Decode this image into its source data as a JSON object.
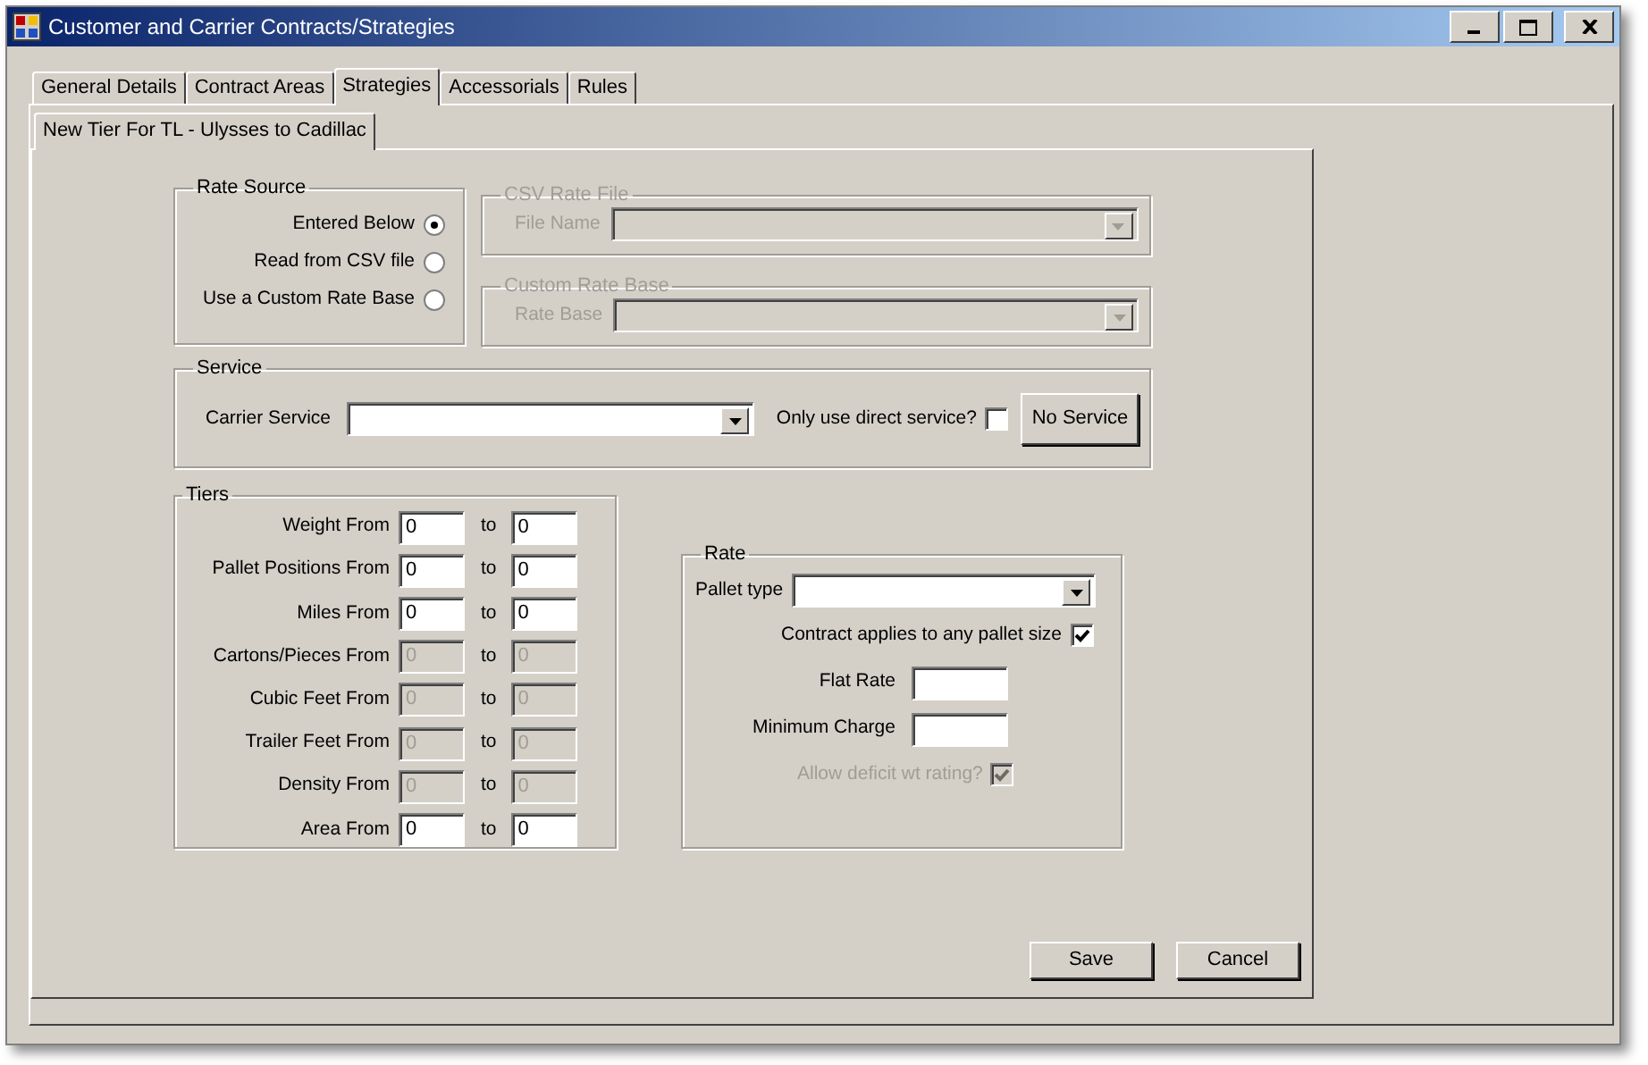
{
  "window": {
    "title": "Customer and Carrier Contracts/Strategies"
  },
  "tabs": [
    {
      "label": "General Details",
      "selected": false
    },
    {
      "label": "Contract Areas",
      "selected": false
    },
    {
      "label": "Strategies",
      "selected": true
    },
    {
      "label": "Accessorials",
      "selected": false
    },
    {
      "label": "Rules",
      "selected": false
    }
  ],
  "subtabs": [
    {
      "label": "New Tier For TL - Ulysses to Cadillac",
      "selected": true
    }
  ],
  "rate_source": {
    "title": "Rate Source",
    "options": [
      {
        "label": "Entered Below",
        "selected": true
      },
      {
        "label": "Read from CSV file",
        "selected": false
      },
      {
        "label": "Use a Custom Rate Base",
        "selected": false
      }
    ]
  },
  "csv_rate_file": {
    "title": "CSV Rate File",
    "disabled": true,
    "field_label": "File Name"
  },
  "custom_rate_base": {
    "title": "Custom Rate Base",
    "disabled": true,
    "field_label": "Rate Base"
  },
  "service": {
    "title": "Service",
    "carrier_service_label": "Carrier Service",
    "direct_label": "Only use direct service?",
    "direct_checked": false,
    "button": "No Service"
  },
  "tiers": {
    "title": "Tiers",
    "rows": [
      {
        "label": "Weight From",
        "from": "0",
        "to_label": "to",
        "to": "0",
        "disabled": false
      },
      {
        "label": "Pallet Positions From",
        "from": "0",
        "to_label": "to",
        "to": "0",
        "disabled": false
      },
      {
        "label": "Miles From",
        "from": "0",
        "to_label": "to",
        "to": "0",
        "disabled": false
      },
      {
        "label": "Cartons/Pieces From",
        "from": "0",
        "to_label": "to",
        "to": "0",
        "disabled": true
      },
      {
        "label": "Cubic Feet From",
        "from": "0",
        "to_label": "to",
        "to": "0",
        "disabled": true
      },
      {
        "label": "Trailer Feet From",
        "from": "0",
        "to_label": "to",
        "to": "0",
        "disabled": true
      },
      {
        "label": "Density From",
        "from": "0",
        "to_label": "to",
        "to": "0",
        "disabled": true
      },
      {
        "label": "Area From",
        "from": "0",
        "to_label": "to",
        "to": "0",
        "disabled": false
      }
    ]
  },
  "rate": {
    "title": "Rate",
    "pallet_type_label": "Pallet type",
    "any_size_label": "Contract applies to any pallet size",
    "any_size_checked": true,
    "flat_rate_label": "Flat Rate",
    "minimum_charge_label": "Minimum Charge",
    "deficit_label": "Allow deficit wt rating?",
    "deficit_checked": true,
    "deficit_disabled": true
  },
  "buttons": [
    "Save",
    "Cancel"
  ]
}
